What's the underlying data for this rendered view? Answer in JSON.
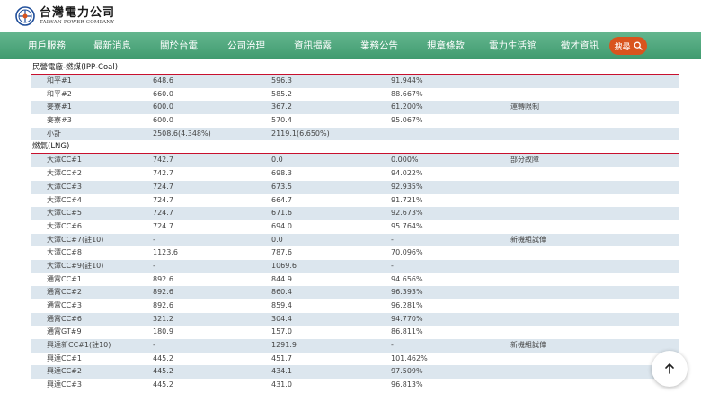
{
  "logo": {
    "cn": "台灣電力公司",
    "en": "TAIWAN POWER COMPANY"
  },
  "nav": [
    {
      "label": "用戶服務"
    },
    {
      "label": "最新消息"
    },
    {
      "label": "關於台電"
    },
    {
      "label": "公司治理"
    },
    {
      "label": "資訊揭露"
    },
    {
      "label": "業務公告"
    },
    {
      "label": "規章條款"
    },
    {
      "label": "電力生活館"
    },
    {
      "label": "徵才資訊"
    }
  ],
  "search": {
    "label": "搜尋"
  },
  "sections": [
    {
      "title": "民營電廠-燃煤(IPP-Coal)",
      "rows": [
        {
          "name": "和平#1",
          "capacity": "648.6",
          "net": "596.3",
          "percent": "91.944%",
          "note": ""
        },
        {
          "name": "和平#2",
          "capacity": "660.0",
          "net": "585.2",
          "percent": "88.667%",
          "note": ""
        },
        {
          "name": "麥寮#1",
          "capacity": "600.0",
          "net": "367.2",
          "percent": "61.200%",
          "note": "運轉限制"
        },
        {
          "name": "麥寮#3",
          "capacity": "600.0",
          "net": "570.4",
          "percent": "95.067%",
          "note": ""
        },
        {
          "name": "小計",
          "capacity": "2508.6(4.348%)",
          "net": "2119.1(6.650%)",
          "percent": "",
          "note": ""
        }
      ]
    },
    {
      "title": "燃氣(LNG)",
      "rows": [
        {
          "name": "大潭CC#1",
          "capacity": "742.7",
          "net": "0.0",
          "percent": "0.000%",
          "note": "部分故障"
        },
        {
          "name": "大潭CC#2",
          "capacity": "742.7",
          "net": "698.3",
          "percent": "94.022%",
          "note": ""
        },
        {
          "name": "大潭CC#3",
          "capacity": "724.7",
          "net": "673.5",
          "percent": "92.935%",
          "note": ""
        },
        {
          "name": "大潭CC#4",
          "capacity": "724.7",
          "net": "664.7",
          "percent": "91.721%",
          "note": ""
        },
        {
          "name": "大潭CC#5",
          "capacity": "724.7",
          "net": "671.6",
          "percent": "92.673%",
          "note": ""
        },
        {
          "name": "大潭CC#6",
          "capacity": "724.7",
          "net": "694.0",
          "percent": "95.764%",
          "note": ""
        },
        {
          "name": "大潭CC#7(註10)",
          "capacity": "-",
          "net": "0.0",
          "percent": "-",
          "note": "新機組試俥"
        },
        {
          "name": "大潭CC#8",
          "capacity": "1123.6",
          "net": "787.6",
          "percent": "70.096%",
          "note": ""
        },
        {
          "name": "大潭CC#9(註10)",
          "capacity": "-",
          "net": "1069.6",
          "percent": "-",
          "note": ""
        },
        {
          "name": "通霄CC#1",
          "capacity": "892.6",
          "net": "844.9",
          "percent": "94.656%",
          "note": ""
        },
        {
          "name": "通霄CC#2",
          "capacity": "892.6",
          "net": "860.4",
          "percent": "96.393%",
          "note": ""
        },
        {
          "name": "通霄CC#3",
          "capacity": "892.6",
          "net": "859.4",
          "percent": "96.281%",
          "note": ""
        },
        {
          "name": "通霄CC#6",
          "capacity": "321.2",
          "net": "304.4",
          "percent": "94.770%",
          "note": ""
        },
        {
          "name": "通霄GT#9",
          "capacity": "180.9",
          "net": "157.0",
          "percent": "86.811%",
          "note": ""
        },
        {
          "name": "興達新CC#1(註10)",
          "capacity": "-",
          "net": "1291.9",
          "percent": "-",
          "note": "新機組試俥"
        },
        {
          "name": "興達CC#1",
          "capacity": "445.2",
          "net": "451.7",
          "percent": "101.462%",
          "note": ""
        },
        {
          "name": "興達CC#2",
          "capacity": "445.2",
          "net": "434.1",
          "percent": "97.509%",
          "note": ""
        },
        {
          "name": "興達CC#3",
          "capacity": "445.2",
          "net": "431.0",
          "percent": "96.813%",
          "note": ""
        }
      ]
    }
  ],
  "icons": {
    "logo": "taipower-logo-icon",
    "search": "search-icon",
    "scroll_top": "arrow-up-icon"
  },
  "colors": {
    "nav_top": "#64b68f",
    "nav_bottom": "#3f9a6e",
    "search": "#d9541e",
    "divider": "#c8102e",
    "row_alt": "#dce6ee"
  }
}
